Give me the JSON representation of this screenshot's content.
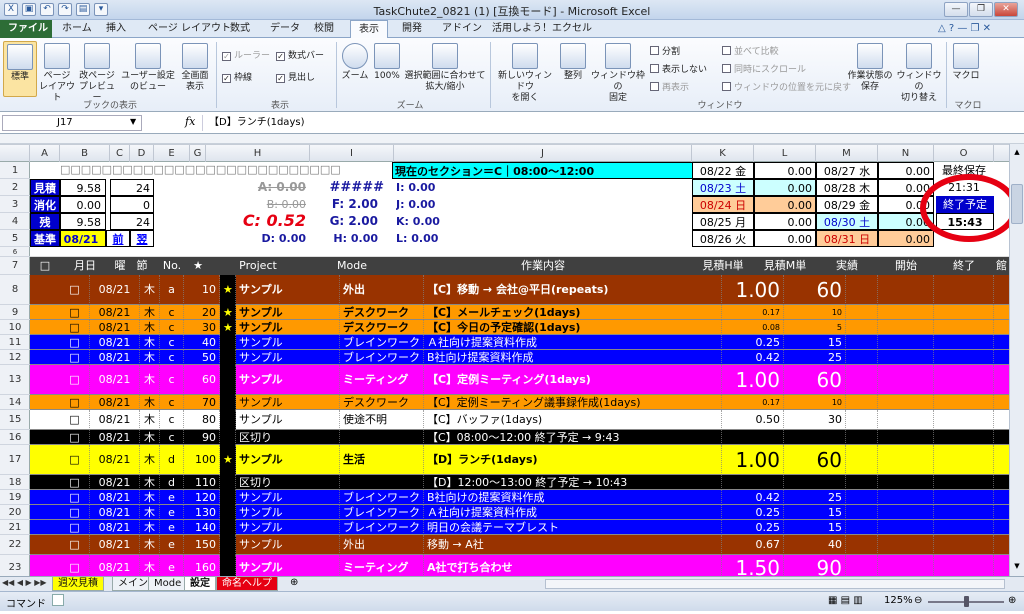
{
  "window": {
    "title": "TaskChute2_0821 (1)  [互換モード]  -  Microsoft Excel"
  },
  "tabs": [
    "ファイル",
    "ホーム",
    "挿入",
    "ページ レイアウト",
    "数式",
    "データ",
    "校閲",
    "表示",
    "開発",
    "アドイン",
    "活用しよう！エクセル"
  ],
  "ribbon": {
    "views": {
      "normal": "標準",
      "page_layout": "ページ\nレイアウト",
      "page_break": "改ページ\nプレビュー",
      "custom": "ユーザー設定\nのビュー",
      "full": "全画面\n表示",
      "group": "ブックの表示"
    },
    "show": {
      "ruler": "ルーラー",
      "formula_bar": "数式バー",
      "gridlines": "枠線",
      "headings": "見出し",
      "group": "表示"
    },
    "zoom": {
      "zoom": "ズーム",
      "z100": "100%",
      "fit": "選択範囲に合わせて\n拡大/縮小",
      "group": "ズーム"
    },
    "window": {
      "new_window": "新しいウィンドウ\nを開く",
      "arrange": "整列",
      "freeze": "ウィンドウ枠の\n固定",
      "split": "分割",
      "hide": "表示しない",
      "unhide": "再表示",
      "side_by_side": "並べて比較",
      "sync_scroll": "同時にスクロール",
      "reset_pos": "ウィンドウの位置を元に戻す",
      "save_ws": "作業状態の\n保存",
      "switch": "ウィンドウの\n切り替え",
      "group": "ウィンドウ"
    },
    "macro": {
      "label": "マクロ",
      "group": "マクロ"
    }
  },
  "formula_bar": {
    "name_box": "J17",
    "fx": "fx",
    "value": "【D】ランチ(1days)"
  },
  "columns": [
    "A",
    "B",
    "C",
    "D",
    "E",
    "G",
    "H",
    "I",
    "J",
    "K",
    "L",
    "M",
    "N",
    "O"
  ],
  "header_area": {
    "row1_boxes": "□□□□□□□□□□□□□□□□□□□□□□□□□□□",
    "section": "現在のセクション＝C｜08:00～12:00",
    "labels": [
      "見積",
      "消化",
      "残",
      "基準"
    ],
    "b_vals": [
      "9.58",
      "0.00",
      "9.58",
      "08/21"
    ],
    "d_vals": [
      "24",
      "0",
      "24"
    ],
    "prev": "前",
    "next": "翌",
    "h_vals": [
      "A: 0.00",
      "B: 0.00",
      "C: 0.52",
      "D: 0.00"
    ],
    "i_vals": [
      "#####",
      "F: 2.00",
      "G: 2.00",
      "H: 0.00"
    ],
    "j_vals": [
      "I: 0.00",
      "J: 0.00",
      "K: 0.00",
      "L: 0.00"
    ],
    "k_vals": [
      "08/22 金",
      "08/23 土",
      "08/24 日",
      "08/25 月",
      "08/26 火"
    ],
    "l_vals": [
      "0.00",
      "0.00",
      "0.00",
      "0.00",
      "0.00"
    ],
    "m_vals": [
      "08/27 水",
      "08/28 木",
      "08/29 金",
      "08/30 土",
      "08/31 日"
    ],
    "n_vals": [
      "0.00",
      "0.00",
      "0.00",
      "0.00",
      "0.00"
    ],
    "o_vals": [
      "最終保存",
      "21:31",
      "終了予定",
      "15:43"
    ]
  },
  "table_header": [
    "□",
    "月日",
    "曜",
    "節",
    "No.",
    "★",
    "Project",
    "Mode",
    "作業内容",
    "見積H単",
    "見積M単",
    "実績",
    "開始",
    "終了",
    "館"
  ],
  "rows": [
    {
      "num": "8",
      "date": "08/21",
      "dow": "木",
      "sec": "a",
      "no": "10",
      "star": "★",
      "project": "サンプル",
      "mode": "外出",
      "task": "【C】移動 → 会社@平日(repeats)",
      "h": "1.00",
      "m": "60"
    },
    {
      "num": "9",
      "date": "08/21",
      "dow": "木",
      "sec": "c",
      "no": "20",
      "star": "★",
      "project": "サンプル",
      "mode": "デスクワーク",
      "task": "【C】メールチェック(1days)",
      "h": "0.17",
      "m": "10"
    },
    {
      "num": "10",
      "date": "08/21",
      "dow": "木",
      "sec": "c",
      "no": "30",
      "star": "★",
      "project": "サンプル",
      "mode": "デスクワーク",
      "task": "【C】今日の予定確認(1days)",
      "h": "0.08",
      "m": "5"
    },
    {
      "num": "11",
      "date": "08/21",
      "dow": "木",
      "sec": "c",
      "no": "40",
      "star": "",
      "project": "サンプル",
      "mode": "ブレインワーク",
      "task": "Ａ社向け提案資料作成",
      "h": "0.25",
      "m": "15"
    },
    {
      "num": "12",
      "date": "08/21",
      "dow": "木",
      "sec": "c",
      "no": "50",
      "star": "",
      "project": "サンプル",
      "mode": "ブレインワーク",
      "task": "B社向け提案資料作成",
      "h": "0.42",
      "m": "25"
    },
    {
      "num": "13",
      "date": "08/21",
      "dow": "木",
      "sec": "c",
      "no": "60",
      "star": "",
      "project": "サンプル",
      "mode": "ミーティング",
      "task": "【C】定例ミーティング(1days)",
      "h": "1.00",
      "m": "60"
    },
    {
      "num": "14",
      "date": "08/21",
      "dow": "木",
      "sec": "c",
      "no": "70",
      "star": "",
      "project": "サンプル",
      "mode": "デスクワーク",
      "task": "【C】定例ミーティング議事録作成(1days)",
      "h": "0.17",
      "m": "10"
    },
    {
      "num": "15",
      "date": "08/21",
      "dow": "木",
      "sec": "c",
      "no": "80",
      "star": "",
      "project": "サンプル",
      "mode": "使途不明",
      "task": "【C】バッファ(1days)",
      "h": "0.50",
      "m": "30"
    },
    {
      "num": "16",
      "date": "08/21",
      "dow": "木",
      "sec": "c",
      "no": "90",
      "star": "",
      "project": "区切り",
      "mode": "",
      "task": "【C】08:00～12:00 終了予定 → 9:43",
      "h": "",
      "m": ""
    },
    {
      "num": "17",
      "date": "08/21",
      "dow": "木",
      "sec": "d",
      "no": "100",
      "star": "★",
      "project": "サンプル",
      "mode": "生活",
      "task": "【D】ランチ(1days)",
      "h": "1.00",
      "m": "60"
    },
    {
      "num": "18",
      "date": "08/21",
      "dow": "木",
      "sec": "d",
      "no": "110",
      "star": "",
      "project": "区切り",
      "mode": "",
      "task": "【D】12:00～13:00 終了予定 → 10:43",
      "h": "",
      "m": ""
    },
    {
      "num": "19",
      "date": "08/21",
      "dow": "木",
      "sec": "e",
      "no": "120",
      "star": "",
      "project": "サンプル",
      "mode": "ブレインワーク",
      "task": "B社向けの提案資料作成",
      "h": "0.42",
      "m": "25"
    },
    {
      "num": "20",
      "date": "08/21",
      "dow": "木",
      "sec": "e",
      "no": "130",
      "star": "",
      "project": "サンプル",
      "mode": "ブレインワーク",
      "task": "Ａ社向け提案資料作成",
      "h": "0.25",
      "m": "15"
    },
    {
      "num": "21",
      "date": "08/21",
      "dow": "木",
      "sec": "e",
      "no": "140",
      "star": "",
      "project": "サンプル",
      "mode": "ブレインワーク",
      "task": "明日の会議テーマブレスト",
      "h": "0.25",
      "m": "15"
    },
    {
      "num": "22",
      "date": "08/21",
      "dow": "木",
      "sec": "e",
      "no": "150",
      "star": "",
      "project": "サンプル",
      "mode": "外出",
      "task": "移動 → A社",
      "h": "0.67",
      "m": "40"
    },
    {
      "num": "23",
      "date": "08/21",
      "dow": "木",
      "sec": "e",
      "no": "160",
      "star": "",
      "project": "サンプル",
      "mode": "ミーティング",
      "task": "A社で打ち合わせ",
      "h": "1.50",
      "m": "90"
    }
  ],
  "sheet_tabs": [
    "週次見積",
    "メイン",
    "Mode",
    "設定",
    "命名ヘルプ"
  ],
  "status": {
    "mode": "コマンド",
    "zoom": "125%"
  },
  "colors": {
    "ribbon_active": "#fbe4a2",
    "file_tab": "#2d6d36",
    "highlight_circle": "#e60012",
    "section_banner": "#00ffff"
  }
}
